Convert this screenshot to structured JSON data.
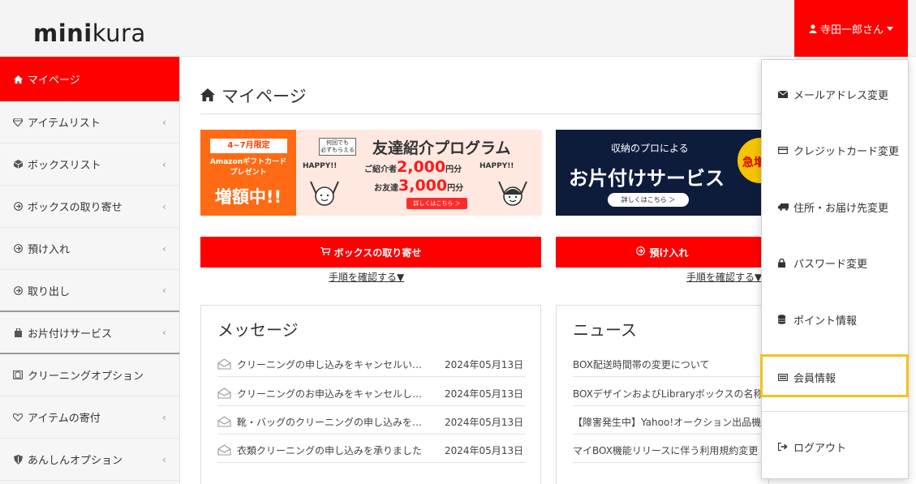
{
  "header": {
    "logo_bold": "mini",
    "logo_light": "kura",
    "user_name": "寺田一郎さん"
  },
  "sidebar": {
    "items": [
      {
        "label": "マイページ",
        "icon": "home-icon",
        "active": true
      },
      {
        "label": "アイテムリスト",
        "icon": "diamond-icon"
      },
      {
        "label": "ボックスリスト",
        "icon": "cube-icon"
      },
      {
        "label": "ボックスの取り寄せ",
        "icon": "circle-arrow-icon"
      },
      {
        "label": "預け入れ",
        "icon": "circle-arrow-icon"
      },
      {
        "label": "取り出し",
        "icon": "circle-arrow-icon"
      },
      {
        "label": "お片付けサービス",
        "icon": "hanger-icon"
      },
      {
        "label": "クリーニングオプション",
        "icon": "shirt-icon"
      },
      {
        "label": "アイテムの寄付",
        "icon": "heart-hand-icon"
      },
      {
        "label": "あんしんオプション",
        "icon": "shield-icon"
      }
    ]
  },
  "main": {
    "title": "マイページ",
    "banner1": {
      "tag": "4~7月限定",
      "sub1": "Amazonギフトカード",
      "sub2": "プレゼント",
      "big": "増額中!!",
      "mini1": "何回でも",
      "mini2": "必ずもらえる",
      "title": "友達紹介プログラム",
      "happy": "HAPPY!!",
      "line1_label": "ご紹介者",
      "line1_value": "2,000",
      "line1_unit": "円分",
      "line2_label": "お友達",
      "line2_value": "3,000",
      "line2_unit": "円分",
      "button": "詳しくはこちら ＞"
    },
    "banner2": {
      "sub": "収納のプロによる",
      "title": "お片付けサービス",
      "button": "詳しくはこちら ＞",
      "badge": "急増"
    },
    "actions": [
      {
        "label": "ボックスの取り寄せ",
        "link": "手順を確認する▼"
      },
      {
        "label": "預け入れ",
        "link": "手順を確認する▼"
      }
    ],
    "messages": {
      "title": "メッセージ",
      "rows": [
        {
          "text": "クリーニングの申し込みをキャンセルい…",
          "date": "2024年05月13日"
        },
        {
          "text": "クリーニングのお申込みをキャンセルし…",
          "date": "2024年05月13日"
        },
        {
          "text": "靴・バッグのクリーニングの申し込みを…",
          "date": "2024年05月13日"
        },
        {
          "text": "衣類クリーニングの申し込みを承りました",
          "date": "2024年05月13日"
        }
      ]
    },
    "news": {
      "title": "ニュース",
      "rows": [
        "BOX配送時間帯の変更について",
        "BOXデザインおよびLibraryボックスの名称",
        "【障害発生中】Yahoo!オークション出品機",
        "マイBOX機能リリースに伴う利用規約変更"
      ]
    }
  },
  "dropdown": {
    "items": [
      {
        "label": "メールアドレス変更",
        "icon": "envelope-icon"
      },
      {
        "label": "クレジットカード変更",
        "icon": "credit-card-icon"
      },
      {
        "label": "住所・お届け先変更",
        "icon": "truck-icon"
      },
      {
        "label": "パスワード変更",
        "icon": "lock-icon"
      },
      {
        "label": "ポイント情報",
        "icon": "coins-icon"
      },
      {
        "label": "会員情報",
        "icon": "id-card-icon"
      },
      {
        "label": "ログアウト",
        "icon": "sign-out-icon"
      }
    ]
  },
  "colors": {
    "brand_red": "#ff0000",
    "highlight": "#f0c419"
  }
}
